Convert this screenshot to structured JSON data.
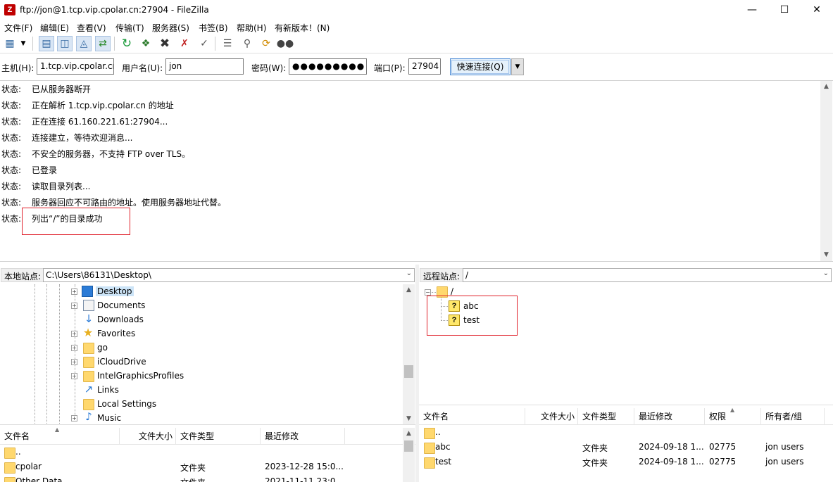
{
  "window": {
    "title": "ftp://jon@1.tcp.vip.cpolar.cn:27904 - FileZilla",
    "app_icon": "Z"
  },
  "menu": [
    "文件(F)",
    "编辑(E)",
    "查看(V)",
    "传输(T)",
    "服务器(S)",
    "书签(B)",
    "帮助(H)",
    "有新版本！(N)"
  ],
  "quickconnect": {
    "host_label": "主机(H):",
    "host": "1.tcp.vip.cpolar.cn",
    "user_label": "用户名(U):",
    "user": "jon",
    "pass_label": "密码(W):",
    "pass": "●●●●●●●●●",
    "port_label": "端口(P):",
    "port": "27904",
    "connect": "快速连接(Q)"
  },
  "log": [
    {
      "k": "状态:",
      "v": "已从服务器断开"
    },
    {
      "k": "状态:",
      "v": "正在解析 1.tcp.vip.cpolar.cn 的地址"
    },
    {
      "k": "状态:",
      "v": "正在连接 61.160.221.61:27904..."
    },
    {
      "k": "状态:",
      "v": "连接建立，等待欢迎消息..."
    },
    {
      "k": "状态:",
      "v": "不安全的服务器，不支持 FTP over TLS。"
    },
    {
      "k": "状态:",
      "v": "已登录"
    },
    {
      "k": "状态:",
      "v": "读取目录列表..."
    },
    {
      "k": "状态:",
      "v": "服务器回应不可路由的地址。使用服务器地址代替。"
    },
    {
      "k": "状态:",
      "v": "列出“/”的目录成功"
    }
  ],
  "local": {
    "label": "本地站点:",
    "path": "C:\\Users\\86131\\Desktop\\",
    "tree": [
      "Desktop",
      "Documents",
      "Downloads",
      "Favorites",
      "go",
      "iCloudDrive",
      "IntelGraphicsProfiles",
      "Links",
      "Local Settings",
      "Music"
    ],
    "columns": [
      "文件名",
      "文件大小",
      "文件类型",
      "最近修改"
    ],
    "rows": [
      {
        "name": "..",
        "size": "",
        "type": "",
        "modified": ""
      },
      {
        "name": "cpolar",
        "size": "",
        "type": "文件夹",
        "modified": "2023-12-28 15:0..."
      },
      {
        "name": "Other Data",
        "size": "",
        "type": "文件夹",
        "modified": "2021-11-11 23:0..."
      }
    ]
  },
  "remote": {
    "label": "远程站点:",
    "path": "/",
    "tree_root": "/",
    "tree": [
      "abc",
      "test"
    ],
    "columns": [
      "文件名",
      "文件大小",
      "文件类型",
      "最近修改",
      "权限",
      "所有者/组"
    ],
    "rows": [
      {
        "name": "..",
        "size": "",
        "type": "",
        "modified": "",
        "perm": "",
        "owner": ""
      },
      {
        "name": "abc",
        "size": "",
        "type": "文件夹",
        "modified": "2024-09-18 1...",
        "perm": "02775",
        "owner": "jon users"
      },
      {
        "name": "test",
        "size": "",
        "type": "文件夹",
        "modified": "2024-09-18 1...",
        "perm": "02775",
        "owner": "jon users"
      }
    ]
  }
}
